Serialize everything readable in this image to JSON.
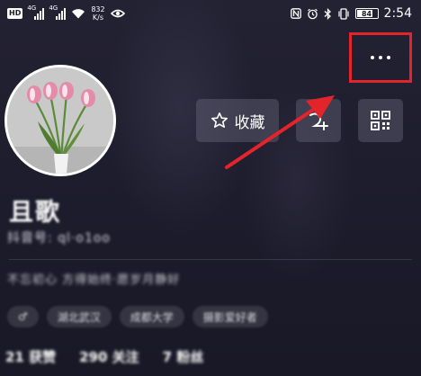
{
  "status_bar": {
    "hd_label": "HD",
    "signal1_label": "4G",
    "signal2_label": "4G",
    "net_speed_value": "832",
    "net_speed_unit": "K/s",
    "battery_level": "84",
    "time": "2:54"
  },
  "profile": {
    "name": "且歌",
    "user_id": "抖音号: ql·o1oo",
    "bio": "不忘初心 方得始终·愿岁月静好",
    "tags": [
      "♂",
      "湖北武汉",
      "成都大学",
      "摄影爱好者"
    ],
    "stats": [
      "21 获赞",
      "290 关注",
      "7 粉丝"
    ]
  },
  "actions": {
    "favorite_label": "收藏",
    "add_friend_icon": "add-friend-icon",
    "qr_icon": "qr-code-icon",
    "more_icon": "more-dots-icon"
  },
  "annotation": {
    "arrow_color": "#e4242b",
    "highlight_color": "#e4242b"
  }
}
